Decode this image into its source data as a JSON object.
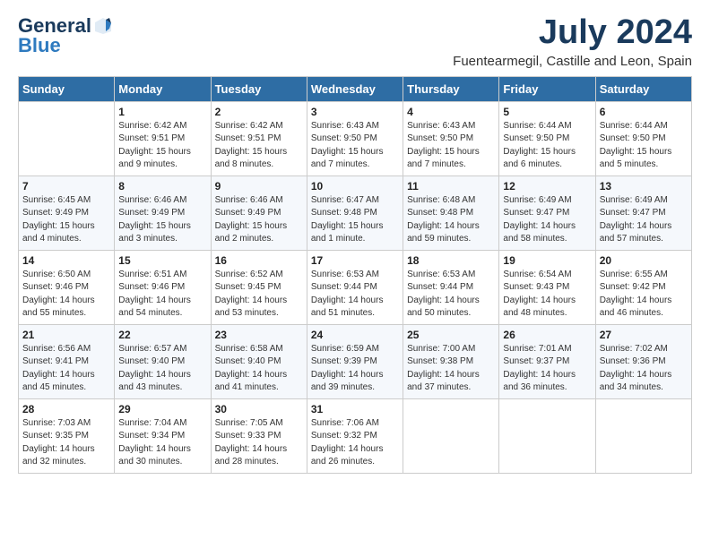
{
  "logo": {
    "general": "General",
    "blue": "Blue"
  },
  "title": {
    "month": "July 2024",
    "location": "Fuentearmegil, Castille and Leon, Spain"
  },
  "headers": [
    "Sunday",
    "Monday",
    "Tuesday",
    "Wednesday",
    "Thursday",
    "Friday",
    "Saturday"
  ],
  "weeks": [
    [
      {
        "day": "",
        "sunrise": "",
        "sunset": "",
        "daylight": ""
      },
      {
        "day": "1",
        "sunrise": "Sunrise: 6:42 AM",
        "sunset": "Sunset: 9:51 PM",
        "daylight": "Daylight: 15 hours and 9 minutes."
      },
      {
        "day": "2",
        "sunrise": "Sunrise: 6:42 AM",
        "sunset": "Sunset: 9:51 PM",
        "daylight": "Daylight: 15 hours and 8 minutes."
      },
      {
        "day": "3",
        "sunrise": "Sunrise: 6:43 AM",
        "sunset": "Sunset: 9:50 PM",
        "daylight": "Daylight: 15 hours and 7 minutes."
      },
      {
        "day": "4",
        "sunrise": "Sunrise: 6:43 AM",
        "sunset": "Sunset: 9:50 PM",
        "daylight": "Daylight: 15 hours and 7 minutes."
      },
      {
        "day": "5",
        "sunrise": "Sunrise: 6:44 AM",
        "sunset": "Sunset: 9:50 PM",
        "daylight": "Daylight: 15 hours and 6 minutes."
      },
      {
        "day": "6",
        "sunrise": "Sunrise: 6:44 AM",
        "sunset": "Sunset: 9:50 PM",
        "daylight": "Daylight: 15 hours and 5 minutes."
      }
    ],
    [
      {
        "day": "7",
        "sunrise": "Sunrise: 6:45 AM",
        "sunset": "Sunset: 9:49 PM",
        "daylight": "Daylight: 15 hours and 4 minutes."
      },
      {
        "day": "8",
        "sunrise": "Sunrise: 6:46 AM",
        "sunset": "Sunset: 9:49 PM",
        "daylight": "Daylight: 15 hours and 3 minutes."
      },
      {
        "day": "9",
        "sunrise": "Sunrise: 6:46 AM",
        "sunset": "Sunset: 9:49 PM",
        "daylight": "Daylight: 15 hours and 2 minutes."
      },
      {
        "day": "10",
        "sunrise": "Sunrise: 6:47 AM",
        "sunset": "Sunset: 9:48 PM",
        "daylight": "Daylight: 15 hours and 1 minute."
      },
      {
        "day": "11",
        "sunrise": "Sunrise: 6:48 AM",
        "sunset": "Sunset: 9:48 PM",
        "daylight": "Daylight: 14 hours and 59 minutes."
      },
      {
        "day": "12",
        "sunrise": "Sunrise: 6:49 AM",
        "sunset": "Sunset: 9:47 PM",
        "daylight": "Daylight: 14 hours and 58 minutes."
      },
      {
        "day": "13",
        "sunrise": "Sunrise: 6:49 AM",
        "sunset": "Sunset: 9:47 PM",
        "daylight": "Daylight: 14 hours and 57 minutes."
      }
    ],
    [
      {
        "day": "14",
        "sunrise": "Sunrise: 6:50 AM",
        "sunset": "Sunset: 9:46 PM",
        "daylight": "Daylight: 14 hours and 55 minutes."
      },
      {
        "day": "15",
        "sunrise": "Sunrise: 6:51 AM",
        "sunset": "Sunset: 9:46 PM",
        "daylight": "Daylight: 14 hours and 54 minutes."
      },
      {
        "day": "16",
        "sunrise": "Sunrise: 6:52 AM",
        "sunset": "Sunset: 9:45 PM",
        "daylight": "Daylight: 14 hours and 53 minutes."
      },
      {
        "day": "17",
        "sunrise": "Sunrise: 6:53 AM",
        "sunset": "Sunset: 9:44 PM",
        "daylight": "Daylight: 14 hours and 51 minutes."
      },
      {
        "day": "18",
        "sunrise": "Sunrise: 6:53 AM",
        "sunset": "Sunset: 9:44 PM",
        "daylight": "Daylight: 14 hours and 50 minutes."
      },
      {
        "day": "19",
        "sunrise": "Sunrise: 6:54 AM",
        "sunset": "Sunset: 9:43 PM",
        "daylight": "Daylight: 14 hours and 48 minutes."
      },
      {
        "day": "20",
        "sunrise": "Sunrise: 6:55 AM",
        "sunset": "Sunset: 9:42 PM",
        "daylight": "Daylight: 14 hours and 46 minutes."
      }
    ],
    [
      {
        "day": "21",
        "sunrise": "Sunrise: 6:56 AM",
        "sunset": "Sunset: 9:41 PM",
        "daylight": "Daylight: 14 hours and 45 minutes."
      },
      {
        "day": "22",
        "sunrise": "Sunrise: 6:57 AM",
        "sunset": "Sunset: 9:40 PM",
        "daylight": "Daylight: 14 hours and 43 minutes."
      },
      {
        "day": "23",
        "sunrise": "Sunrise: 6:58 AM",
        "sunset": "Sunset: 9:40 PM",
        "daylight": "Daylight: 14 hours and 41 minutes."
      },
      {
        "day": "24",
        "sunrise": "Sunrise: 6:59 AM",
        "sunset": "Sunset: 9:39 PM",
        "daylight": "Daylight: 14 hours and 39 minutes."
      },
      {
        "day": "25",
        "sunrise": "Sunrise: 7:00 AM",
        "sunset": "Sunset: 9:38 PM",
        "daylight": "Daylight: 14 hours and 37 minutes."
      },
      {
        "day": "26",
        "sunrise": "Sunrise: 7:01 AM",
        "sunset": "Sunset: 9:37 PM",
        "daylight": "Daylight: 14 hours and 36 minutes."
      },
      {
        "day": "27",
        "sunrise": "Sunrise: 7:02 AM",
        "sunset": "Sunset: 9:36 PM",
        "daylight": "Daylight: 14 hours and 34 minutes."
      }
    ],
    [
      {
        "day": "28",
        "sunrise": "Sunrise: 7:03 AM",
        "sunset": "Sunset: 9:35 PM",
        "daylight": "Daylight: 14 hours and 32 minutes."
      },
      {
        "day": "29",
        "sunrise": "Sunrise: 7:04 AM",
        "sunset": "Sunset: 9:34 PM",
        "daylight": "Daylight: 14 hours and 30 minutes."
      },
      {
        "day": "30",
        "sunrise": "Sunrise: 7:05 AM",
        "sunset": "Sunset: 9:33 PM",
        "daylight": "Daylight: 14 hours and 28 minutes."
      },
      {
        "day": "31",
        "sunrise": "Sunrise: 7:06 AM",
        "sunset": "Sunset: 9:32 PM",
        "daylight": "Daylight: 14 hours and 26 minutes."
      },
      {
        "day": "",
        "sunrise": "",
        "sunset": "",
        "daylight": ""
      },
      {
        "day": "",
        "sunrise": "",
        "sunset": "",
        "daylight": ""
      },
      {
        "day": "",
        "sunrise": "",
        "sunset": "",
        "daylight": ""
      }
    ]
  ]
}
